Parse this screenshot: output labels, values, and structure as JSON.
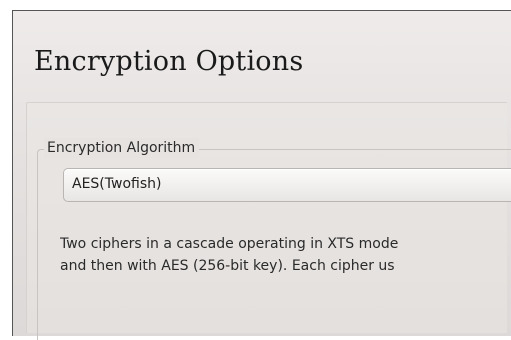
{
  "page": {
    "title": "Encryption Options"
  },
  "encryption_algorithm": {
    "group_label": "Encryption Algorithm",
    "selected": "AES(Twofish)"
  },
  "description": {
    "line1": "Two ciphers in a cascade operating in XTS mode",
    "line2": "and then with AES (256-bit key). Each cipher us"
  }
}
